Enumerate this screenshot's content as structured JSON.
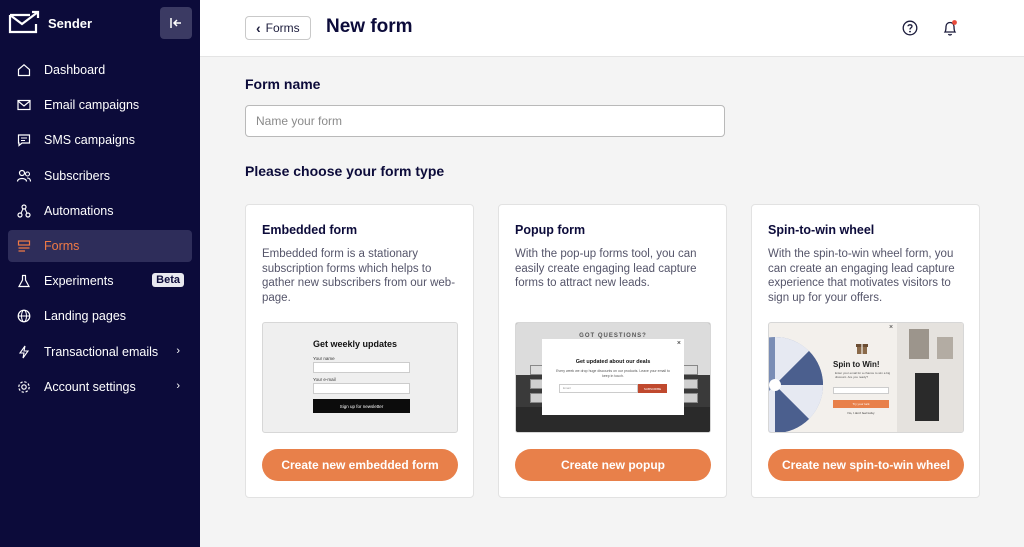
{
  "brand": {
    "name": "Sender"
  },
  "sidebar": {
    "items": [
      {
        "label": "Dashboard",
        "icon": "home-icon"
      },
      {
        "label": "Email campaigns",
        "icon": "mail-icon"
      },
      {
        "label": "SMS campaigns",
        "icon": "chat-icon"
      },
      {
        "label": "Subscribers",
        "icon": "users-icon"
      },
      {
        "label": "Automations",
        "icon": "automation-icon"
      },
      {
        "label": "Forms",
        "icon": "forms-icon",
        "active": true
      },
      {
        "label": "Experiments",
        "icon": "flask-icon",
        "badge": "Beta"
      },
      {
        "label": "Landing pages",
        "icon": "globe-icon"
      },
      {
        "label": "Transactional emails",
        "icon": "lightning-icon",
        "chevron": "›"
      },
      {
        "label": "Account settings",
        "icon": "gear-icon",
        "chevron": "›"
      }
    ]
  },
  "header": {
    "back_label": "Forms",
    "back_chevron": "‹",
    "title": "New form"
  },
  "main": {
    "form_name_label": "Form name",
    "form_name_placeholder": "Name your form",
    "form_name_value": "",
    "type_heading": "Please choose your form type",
    "cards": [
      {
        "title": "Embedded form",
        "description": "Embedded form is a stationary subscription forms which helps to gather new subscribers from our web-page.",
        "button": "Create new embedded form",
        "preview": {
          "title": "Get weekly updates",
          "label_name": "Your name",
          "label_email": "Your e-mail",
          "submit": "Sign up for newsletter"
        }
      },
      {
        "title": "Popup form",
        "description": "With the pop-up forms tool, you can easily create engaging lead capture forms to attract new leads.",
        "button": "Create new popup",
        "preview": {
          "bg_text": "GOT QUESTIONS?",
          "title": "Get updated about our deals",
          "subtitle": "Every week we drop huge discounts on our products. Leave your email to keep in touch.",
          "placeholder": "Email",
          "submit": "SUBSCRIBE",
          "close": "×"
        }
      },
      {
        "title": "Spin-to-win wheel",
        "description": "With the spin-to-win wheel form, you can create an engaging lead capture experience that motivates visitors to sign up for your offers.",
        "button": "Create new spin-to-win wheel",
        "preview": {
          "title": "Spin to Win!",
          "subtitle": "Enter your email for a chance to win a big discount. Are you ready?",
          "submit": "Try your luck",
          "no": "No, I don't feel lucky",
          "close": "×"
        }
      }
    ]
  },
  "colors": {
    "sidebar_bg": "#0c0b3a",
    "accent": "#e8804a",
    "active_text": "#f07a45"
  }
}
